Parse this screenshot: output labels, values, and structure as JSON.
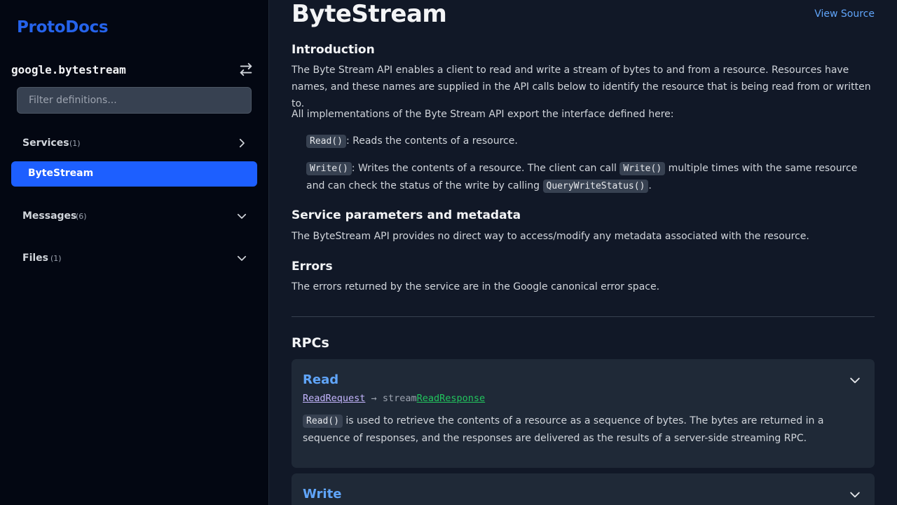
{
  "brand": {
    "name": "ProtoDocs",
    "color": "#2563eb"
  },
  "sidebar": {
    "package": "google.bytestream",
    "filter_placeholder": "Filter definitions...",
    "services": {
      "label": "Services",
      "count": "(1)",
      "items": [
        "ByteStream"
      ]
    },
    "messages": {
      "label": "Messages",
      "count": "(6)"
    },
    "files": {
      "label": "Files",
      "count": "(1)"
    }
  },
  "main": {
    "title": "ByteStream",
    "view_source": "View Source",
    "intro": {
      "heading": "Introduction",
      "p1": "The Byte Stream API enables a client to read and write a stream of bytes to and from a resource. Resources have names, and these names are supplied in the API calls below to identify the resource that is being read from or written to.",
      "p2": "All implementations of the Byte Stream API export the interface defined here:",
      "item1_code": "Read()",
      "item1_text": ": Reads the contents of a resource.",
      "item2_code": "Write()",
      "item2_text_a": ": Writes the contents of a resource. The client can call ",
      "item2_code2": "Write()",
      "item2_text_b": " multiple times with the same resource and can check the status of the write by calling ",
      "item2_code3": "QueryWriteStatus()",
      "item2_text_c": "."
    },
    "params": {
      "heading": "Service parameters and metadata",
      "text": "The ByteStream API provides no direct way to access/modify any metadata associated with the resource."
    },
    "errors": {
      "heading": "Errors",
      "text": "The errors returned by the service are in the Google canonical error space."
    },
    "rpcs": {
      "heading": "RPCs",
      "items": [
        {
          "name": "Read",
          "request": "ReadRequest",
          "arrow": "→",
          "stream": "stream",
          "response": "ReadResponse",
          "desc_code": "Read()",
          "desc_text": " is used to retrieve the contents of a resource as a sequence of bytes. The bytes are returned in a sequence of responses, and the responses are delivered as the results of a server-side streaming RPC."
        },
        {
          "name": "Write"
        }
      ]
    }
  }
}
